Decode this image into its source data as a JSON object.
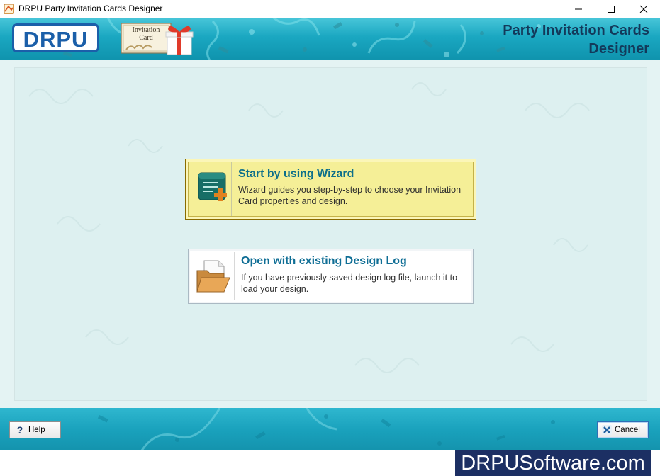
{
  "window": {
    "title": "DRPU Party Invitation Cards Designer",
    "controls": [
      "minimize-icon",
      "maximize-icon",
      "close-icon"
    ]
  },
  "header": {
    "brand": "DRPU",
    "card_logo_text": [
      "Invitation",
      "Card"
    ],
    "product_title_line1": "Party Invitation Cards",
    "product_title_line2": "Designer"
  },
  "options": {
    "wizard": {
      "title": "Start by using Wizard",
      "description": "Wizard guides you step-by-step to choose your Invitation Card properties and design.",
      "icon": "wizard-add-icon"
    },
    "open_log": {
      "title": "Open with existing Design Log",
      "description": "If you have previously saved design log file, launch it to load your design.",
      "icon": "folder-document-icon"
    }
  },
  "footer": {
    "help_label": "Help",
    "cancel_label": "Cancel"
  },
  "watermark": "DRPUSoftware.com",
  "colors": {
    "header_teal": "#1aa7c1",
    "brand_blue": "#1b5fa9",
    "wizard_highlight": "#f5ef97",
    "title_blue": "#0f6e95",
    "watermark_bg": "#1c2f63"
  }
}
